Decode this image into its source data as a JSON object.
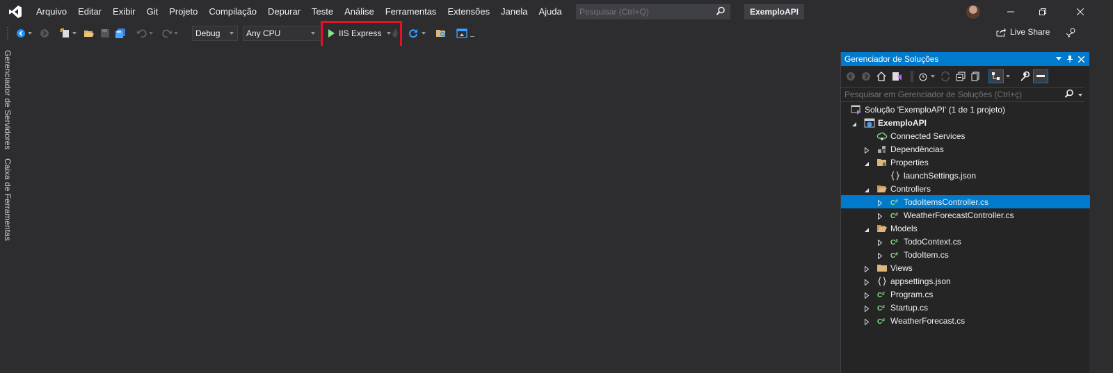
{
  "menu": {
    "items": [
      "Arquivo",
      "Editar",
      "Exibir",
      "Git",
      "Projeto",
      "Compilação",
      "Depurar",
      "Teste",
      "Análise",
      "Ferramentas",
      "Extensões",
      "Janela",
      "Ajuda"
    ]
  },
  "search": {
    "placeholder": "Pesquisar (Ctrl+Q)"
  },
  "solution_name": "ExemploAPI",
  "toolbar": {
    "config": "Debug",
    "platform": "Any CPU",
    "run_label": "IIS Express",
    "live_share": "Live Share"
  },
  "side_tabs": [
    "Gerenciador de Servidores",
    "Caixa de Ferramentas"
  ],
  "solution_explorer": {
    "title": "Gerenciador de Soluções",
    "search_placeholder": "Pesquisar em Gerenciador de Soluções (Ctrl+ç)",
    "tree": [
      {
        "label": "Solução 'ExemploAPI' (1 de 1 projeto)",
        "icon": "solution-icon",
        "expander": "none",
        "level": 0,
        "bold": false,
        "selected": false
      },
      {
        "label": "ExemploAPI",
        "icon": "web-project-icon",
        "expander": "open",
        "level": 0,
        "bold": true,
        "selected": false
      },
      {
        "label": "Connected Services",
        "icon": "connected-services-icon",
        "expander": "none",
        "level": 1,
        "bold": false,
        "selected": false
      },
      {
        "label": "Dependências",
        "icon": "dependencies-icon",
        "expander": "closed",
        "level": 1,
        "bold": false,
        "selected": false
      },
      {
        "label": "Properties",
        "icon": "properties-folder-icon",
        "expander": "open",
        "level": 1,
        "bold": false,
        "selected": false
      },
      {
        "label": "launchSettings.json",
        "icon": "json-file-icon",
        "expander": "none",
        "level": 2,
        "bold": false,
        "selected": false
      },
      {
        "label": "Controllers",
        "icon": "folder-open-icon",
        "expander": "open",
        "level": 1,
        "bold": false,
        "selected": false
      },
      {
        "label": "TodoItemsController.cs",
        "icon": "csharp-file-icon",
        "expander": "closed",
        "level": 2,
        "bold": false,
        "selected": true
      },
      {
        "label": "WeatherForecastController.cs",
        "icon": "csharp-file-icon",
        "expander": "closed",
        "level": 2,
        "bold": false,
        "selected": false
      },
      {
        "label": "Models",
        "icon": "folder-open-icon",
        "expander": "open",
        "level": 1,
        "bold": false,
        "selected": false
      },
      {
        "label": "TodoContext.cs",
        "icon": "csharp-file-icon",
        "expander": "closed",
        "level": 2,
        "bold": false,
        "selected": false
      },
      {
        "label": "TodoItem.cs",
        "icon": "csharp-file-icon",
        "expander": "closed",
        "level": 2,
        "bold": false,
        "selected": false
      },
      {
        "label": "Views",
        "icon": "folder-icon",
        "expander": "closed",
        "level": 1,
        "bold": false,
        "selected": false
      },
      {
        "label": "appsettings.json",
        "icon": "json-file-icon",
        "expander": "closed",
        "level": 1,
        "bold": false,
        "selected": false
      },
      {
        "label": "Program.cs",
        "icon": "csharp-file-icon",
        "expander": "closed",
        "level": 1,
        "bold": false,
        "selected": false
      },
      {
        "label": "Startup.cs",
        "icon": "csharp-file-icon",
        "expander": "closed",
        "level": 1,
        "bold": false,
        "selected": false
      },
      {
        "label": "WeatherForecast.cs",
        "icon": "csharp-file-icon",
        "expander": "closed",
        "level": 1,
        "bold": false,
        "selected": false
      }
    ]
  },
  "colors": {
    "accent": "#007acc",
    "highlight_box": "#e81123",
    "run_green": "#8ae28a",
    "csharp_green": "#8ae28a"
  }
}
